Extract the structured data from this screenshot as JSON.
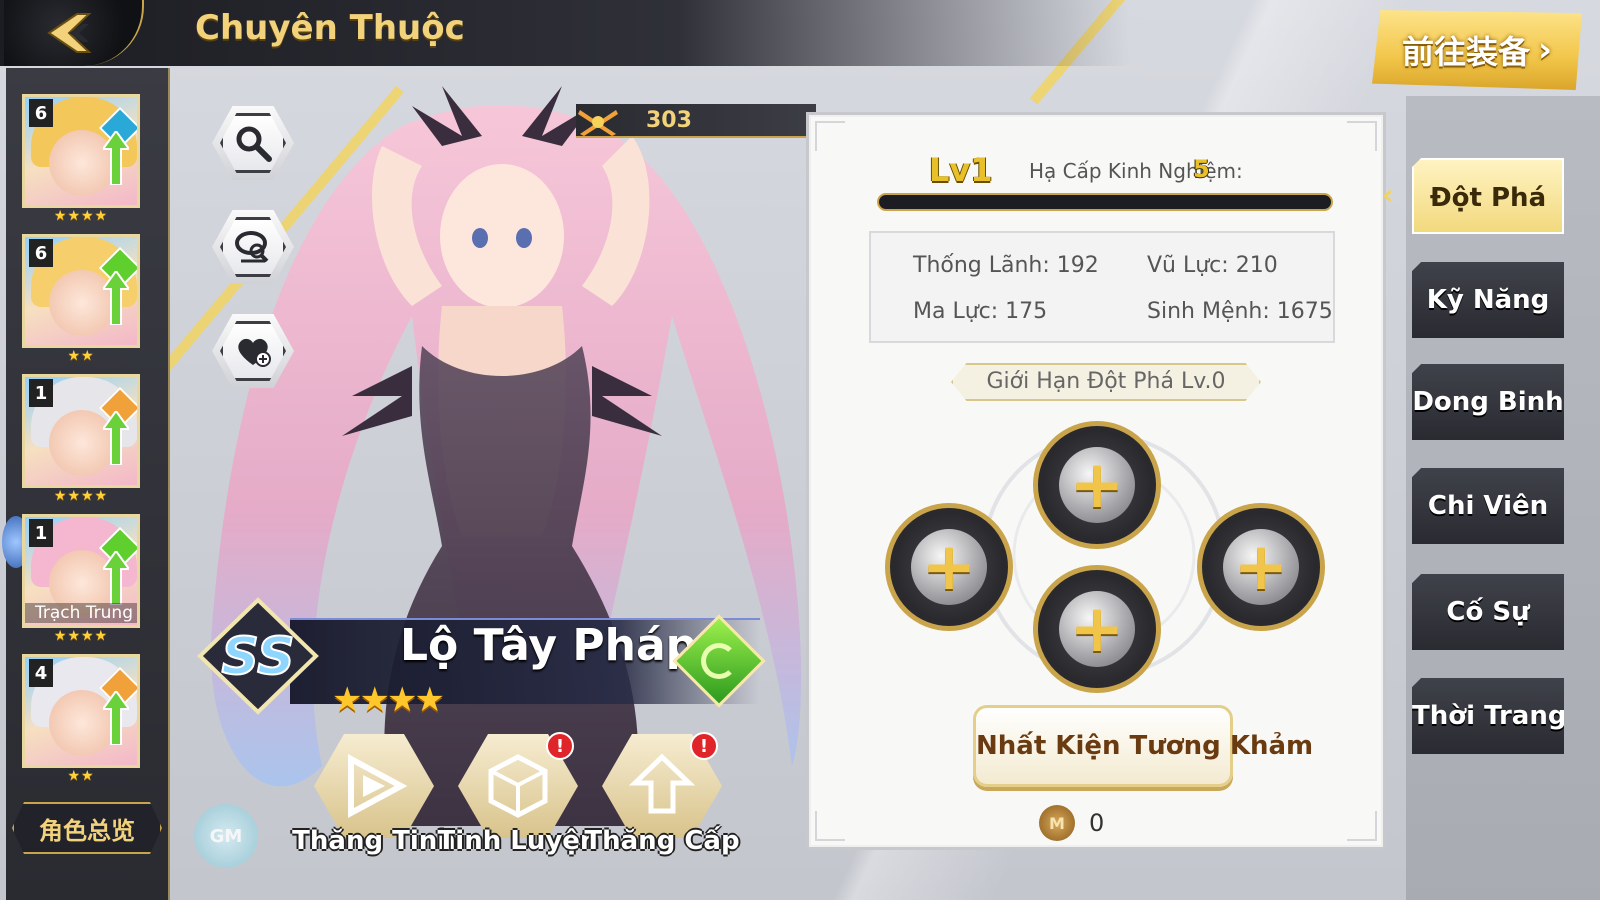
{
  "header": {
    "title": "Chuyên Thuộc",
    "goto_equip_label": "前往装备"
  },
  "roster": {
    "cards": [
      {
        "level": "6",
        "stars": "★★★★",
        "hair_color": "#f3c75a",
        "element_color": "#2aa8d8",
        "name_overlay": ""
      },
      {
        "level": "6",
        "stars": "★★",
        "hair_color": "#f6cf6c",
        "element_color": "#5fcf2e",
        "name_overlay": ""
      },
      {
        "level": "1",
        "stars": "★★★★",
        "hair_color": "#e6e6ea",
        "element_color": "#f0a13a",
        "name_overlay": ""
      },
      {
        "level": "1",
        "stars": "★★★★",
        "hair_color": "#f4b7cf",
        "element_color": "#5fcf2e",
        "name_overlay": "Trạch Trung"
      },
      {
        "level": "4",
        "stars": "★★",
        "hair_color": "#e8e8ee",
        "element_color": "#f0a13a",
        "name_overlay": ""
      }
    ],
    "overview_label": "角色总览"
  },
  "character": {
    "power": "303",
    "name": "Lộ Tây Pháp",
    "rarity": "SS",
    "stars": "★★★★",
    "element": "wind",
    "hair_color": "#f5b8cf"
  },
  "actions": [
    {
      "label": "Thăng Tinh",
      "icon": "star-up-icon",
      "alert": false
    },
    {
      "label": "Tinh Luyện",
      "icon": "cube-icon",
      "alert": true
    },
    {
      "label": "Thăng Cấp",
      "icon": "level-up-icon",
      "alert": true
    }
  ],
  "panel": {
    "level": "Lv1",
    "exp_label": "Hạ Cấp Kinh Nghiệm:",
    "exp_value": "5",
    "exp_progress": 0,
    "stats": {
      "command_label": "Thống Lãnh:",
      "command": "192",
      "force_label": "Vũ Lực:",
      "force": "210",
      "magic_label": "Ma Lực:",
      "magic": "175",
      "life_label": "Sinh Mệnh:",
      "life": "1675"
    },
    "limit_label": "Giới Hạn Đột Phá  Lv.0",
    "inlay_button": "Nhất Kiện Tương Khảm",
    "currency_icon": "M",
    "currency_value": "0"
  },
  "tabs": [
    {
      "label": "Đột Phá",
      "active": true
    },
    {
      "label": "Kỹ Năng",
      "active": false
    },
    {
      "label": "Dong Binh",
      "active": false
    },
    {
      "label": "Chi Viên",
      "active": false
    },
    {
      "label": "Cố Sự",
      "active": false
    },
    {
      "label": "Thời Trang",
      "active": false
    }
  ],
  "gm_label": "GM"
}
